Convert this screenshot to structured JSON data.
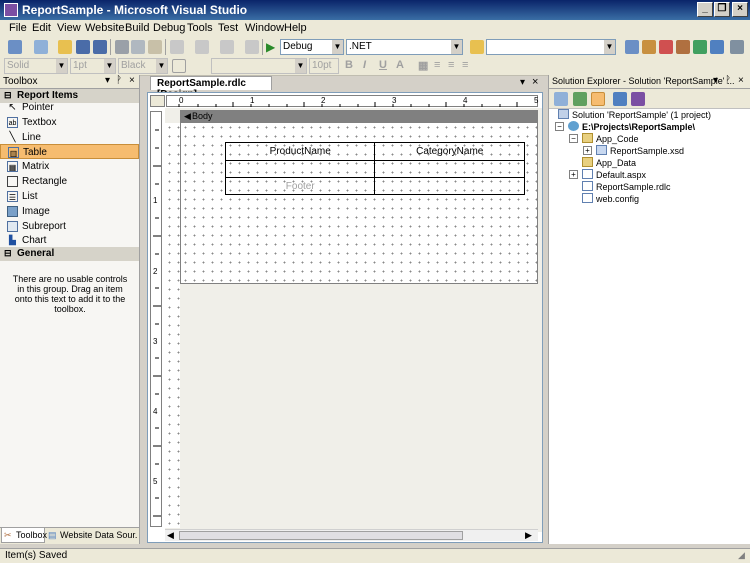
{
  "window": {
    "title": "ReportSample - Microsoft Visual Studio"
  },
  "menu": [
    "File",
    "Edit",
    "View",
    "Website",
    "Build",
    "Debug",
    "Tools",
    "Test",
    "Window",
    "Help"
  ],
  "toolbar1": {
    "config": "Debug",
    "platform": ".NET"
  },
  "toolbar2": {
    "border_style": "Solid",
    "border_width": "1pt",
    "border_color": "Black",
    "font_size": "10pt"
  },
  "toolbox": {
    "title": "Toolbox",
    "section_report": "Report Items",
    "items": [
      {
        "label": "Pointer",
        "icon": "pointer-icon"
      },
      {
        "label": "Textbox",
        "icon": "textbox-icon"
      },
      {
        "label": "Line",
        "icon": "line-icon"
      },
      {
        "label": "Table",
        "icon": "table-icon"
      },
      {
        "label": "Matrix",
        "icon": "matrix-icon"
      },
      {
        "label": "Rectangle",
        "icon": "rectangle-icon"
      },
      {
        "label": "List",
        "icon": "list-icon"
      },
      {
        "label": "Image",
        "icon": "image-icon"
      },
      {
        "label": "Subreport",
        "icon": "subreport-icon"
      },
      {
        "label": "Chart",
        "icon": "chart-icon"
      }
    ],
    "section_general": "General",
    "general_message": "There are no usable controls in this group. Drag an item onto this text to add it to the toolbox.",
    "bottom_tabs": [
      "Toolbox",
      "Website Data Sour..."
    ]
  },
  "document": {
    "tab_label": "ReportSample.rdlc [Design]",
    "body_label": "Body",
    "table": {
      "headers": [
        "ProductName",
        "CategoryName"
      ],
      "footer_placeholder": "Footer"
    },
    "ruler_h": [
      "0",
      "1",
      "2",
      "3",
      "4",
      "5"
    ],
    "ruler_v": [
      "1",
      "2",
      "3",
      "4",
      "5"
    ]
  },
  "solution_explorer": {
    "title": "Solution Explorer - Solution 'ReportSample' ...",
    "solution": "Solution 'ReportSample' (1 project)",
    "project": "E:\\Projects\\ReportSample\\",
    "app_code": "App_Code",
    "xsd": "ReportSample.xsd",
    "app_data": "App_Data",
    "default_aspx": "Default.aspx",
    "rdlc": "ReportSample.rdlc",
    "web_config": "web.config"
  },
  "status": {
    "text": "Item(s) Saved"
  },
  "colors": {
    "titlebar": "#0a246a",
    "selected": "#f6bc6f"
  }
}
